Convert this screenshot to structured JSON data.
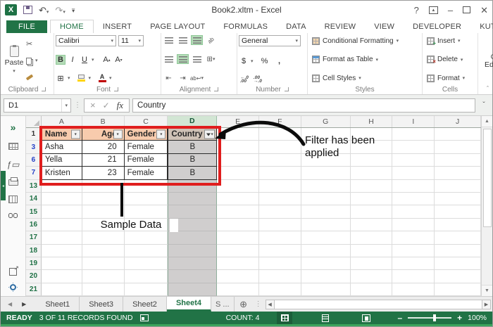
{
  "titlebar": {
    "title": "Book2.xltm - Excel",
    "help_label": "?"
  },
  "ribbon_tabs": [
    {
      "label": "FILE",
      "type": "file"
    },
    {
      "label": "HOME",
      "active": true
    },
    {
      "label": "INSERT"
    },
    {
      "label": "PAGE LAYOUT"
    },
    {
      "label": "FORMULAS"
    },
    {
      "label": "DATA"
    },
    {
      "label": "REVIEW"
    },
    {
      "label": "VIEW"
    },
    {
      "label": "DEVELOPER"
    },
    {
      "label": "KUTOOLS ™"
    },
    {
      "label": "K",
      "cut": true
    }
  ],
  "ribbon": {
    "clipboard": {
      "label": "Clipboard",
      "paste_label": "Paste"
    },
    "font": {
      "label": "Font",
      "family": "Calibri",
      "size": "11",
      "bold": "B",
      "italic": "I",
      "underline": "U"
    },
    "alignment": {
      "label": "Alignment"
    },
    "number": {
      "label": "Number",
      "format": "General",
      "currency": "$",
      "percent": "%",
      "comma": ","
    },
    "styles": {
      "label": "Styles",
      "items": [
        "Conditional Formatting",
        "Format as Table",
        "Cell Styles"
      ]
    },
    "cells": {
      "label": "Cells",
      "items": [
        "Insert",
        "Delete",
        "Format"
      ]
    },
    "editing": {
      "label": "Editing"
    }
  },
  "formula_bar": {
    "name_box": "D1",
    "fx_label": "fx",
    "value": "Country"
  },
  "grid": {
    "columns": [
      "A",
      "B",
      "C",
      "D",
      "E",
      "F",
      "G",
      "H",
      "I",
      "J"
    ],
    "selected_column": "D",
    "visible_rows": [
      1,
      3,
      6,
      7,
      13,
      14,
      15,
      16,
      17,
      18,
      19,
      20,
      21
    ],
    "blue_filtered_rows": [
      3,
      6,
      7
    ]
  },
  "table": {
    "headers": [
      "Name",
      "Age",
      "Gender",
      "Country"
    ],
    "rows": [
      [
        "Asha",
        "20",
        "Female",
        "B"
      ],
      [
        "Yella",
        "21",
        "Female",
        "B"
      ],
      [
        "Kristen",
        "23",
        "Female",
        "B"
      ]
    ]
  },
  "annotations": {
    "filter_note": "Filter has been applied",
    "sample_note": "Sample Data"
  },
  "sheet_tabs": [
    {
      "label": "Sheet1"
    },
    {
      "label": "Sheet3"
    },
    {
      "label": "Sheet2"
    },
    {
      "label": "Sheet4",
      "active": true
    },
    {
      "label": "S ...",
      "cut": true
    }
  ],
  "status_bar": {
    "mode": "READY",
    "records": "3 OF 11 RECORDS FOUND",
    "count": "COUNT: 4",
    "zoom_level": "100%"
  },
  "colors": {
    "accent_green": "#217346",
    "table_header_bg": "#F8CBAD",
    "selected_column_bg": "#D0CECE",
    "annotation_red": "#E01E1E",
    "filtered_row_number_blue": "#2742C8"
  }
}
